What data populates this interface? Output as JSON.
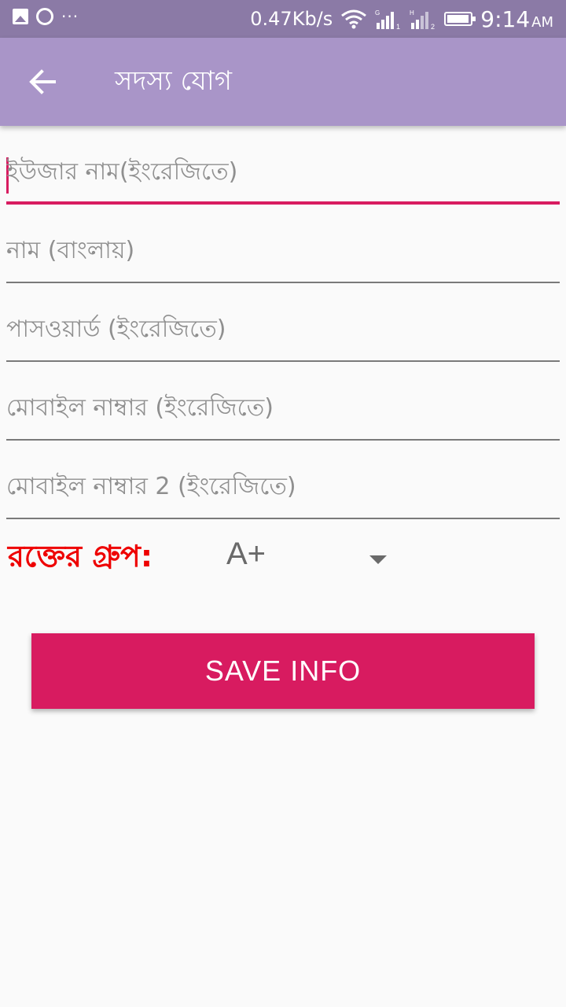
{
  "status_bar": {
    "speed": "0.47Kb/s",
    "time": "9:14",
    "ampm": "AM",
    "more": "···",
    "icons": [
      "image-icon",
      "swirl-icon",
      "wifi-icon",
      "signal-sim1-icon",
      "signal-sim2-icon",
      "battery-icon"
    ],
    "signal_labels": {
      "sim1_type": "G",
      "sim1_num": "1",
      "sim2_type": "H",
      "sim2_num": "2"
    },
    "bar_color": "#8b7aa6"
  },
  "app_bar": {
    "title": "সদস্য যোগ",
    "back_icon": "arrow-left-icon",
    "color": "#a995c8"
  },
  "form": {
    "fields": [
      {
        "placeholder": "ইউজার নাম(ইংরেজিতে)",
        "value": "",
        "active": true
      },
      {
        "placeholder": "নাম (বাংলায়)",
        "value": "",
        "active": false
      },
      {
        "placeholder": "পাসওয়ার্ড (ইংরেজিতে)",
        "value": "",
        "active": false
      },
      {
        "placeholder": "মোবাইল নাম্বার (ইংরেজিতে)",
        "value": "",
        "active": false
      },
      {
        "placeholder": "মোবাইল নাম্বার 2 (ইংরেজিতে)",
        "value": "",
        "active": false
      }
    ],
    "accent_color": "#d81b60"
  },
  "blood_group": {
    "label": "রক্তের গ্রুপ:",
    "selected": "A+",
    "label_color": "#ee0000"
  },
  "save_button": {
    "label": "SAVE INFO",
    "color": "#d81b60"
  }
}
